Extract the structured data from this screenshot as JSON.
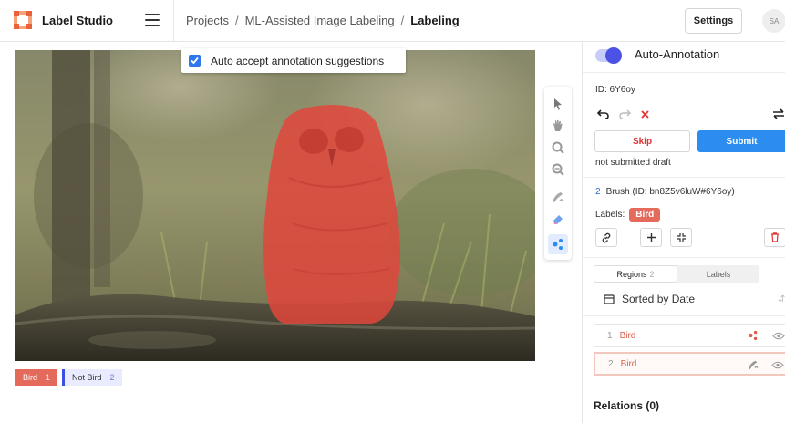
{
  "app": {
    "name": "Label Studio"
  },
  "breadcrumb": {
    "projects": "Projects",
    "project": "ML-Assisted Image Labeling",
    "current": "Labeling",
    "separator": "/"
  },
  "header": {
    "settings_label": "Settings",
    "avatar_initials": "SA"
  },
  "canvas": {
    "auto_accept_label": "Auto accept annotation suggestions",
    "auto_accept_checked": true
  },
  "label_bar": {
    "labels": [
      {
        "name": "Bird",
        "count": "1",
        "color": "#e46a5b"
      },
      {
        "name": "Not Bird",
        "count": "2",
        "color": "#3b4ee8"
      }
    ]
  },
  "panel": {
    "auto_annotation_label": "Auto-Annotation",
    "auto_annotation_on": true,
    "annotation_id": "ID: 6Y6oy",
    "skip_label": "Skip",
    "submit_label": "Submit",
    "draft_status": "not submitted draft",
    "selected_region": {
      "index": "2",
      "title": "Brush (ID: bn8Z5v6luW#6Y6oy)"
    },
    "labels_prefix": "Labels:",
    "selected_label": "Bird",
    "tabs": [
      {
        "label": "Regions",
        "count": "2",
        "active": true
      },
      {
        "label": "Labels",
        "active": false
      }
    ],
    "sort_label": "Sorted by Date",
    "regions": [
      {
        "index": "1",
        "label": "Bird",
        "tool_icon": "auto-detect-icon"
      },
      {
        "index": "2",
        "label": "Bird",
        "tool_icon": "brush-icon"
      }
    ],
    "relations_label": "Relations (0)"
  },
  "colors": {
    "accent": "#2d8cf0",
    "bird": "#e46a5b",
    "not_bird": "#3b4ee8",
    "skip": "#e03232"
  }
}
